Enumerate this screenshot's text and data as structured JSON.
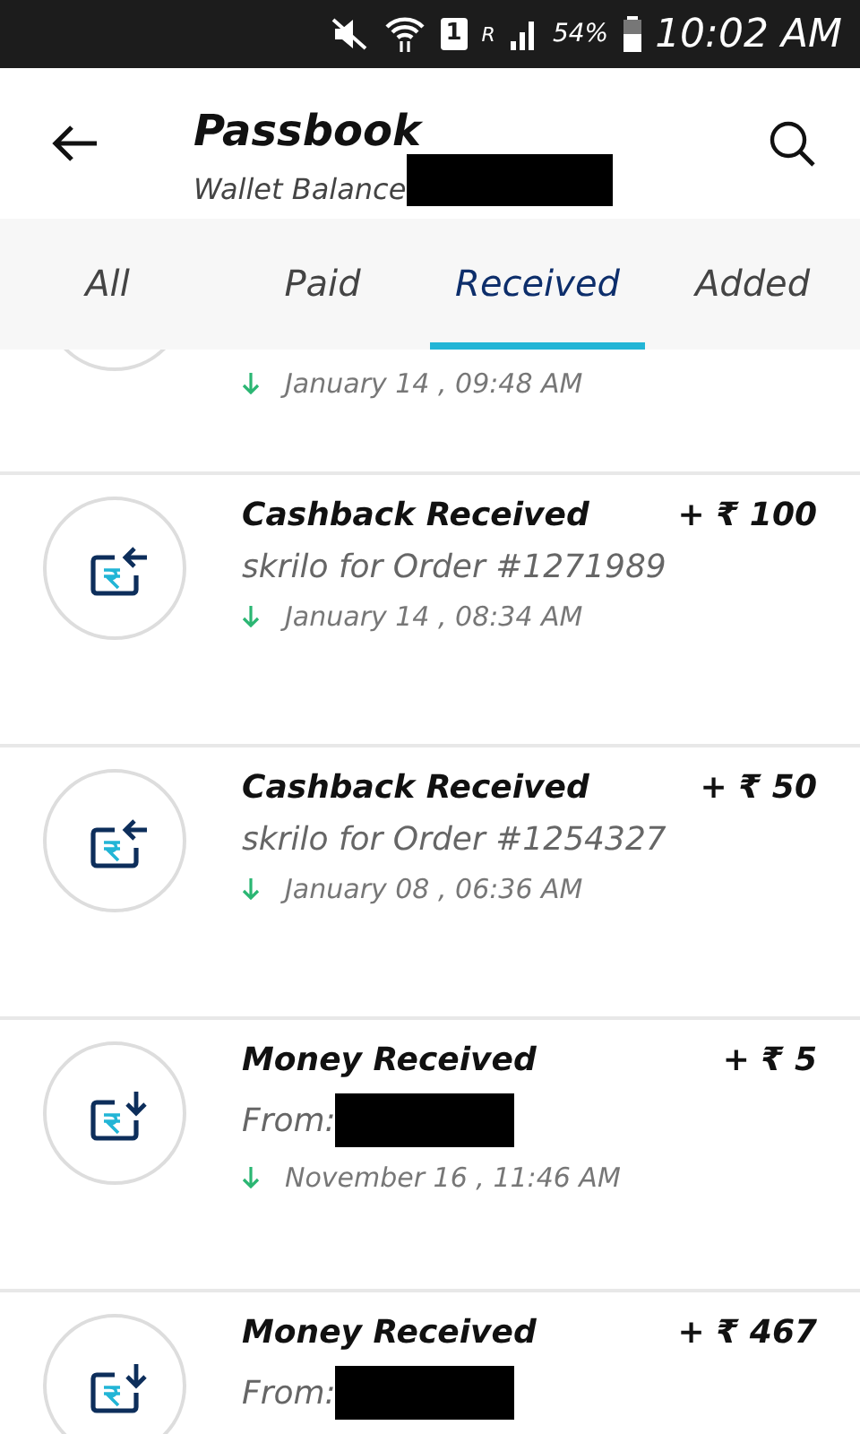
{
  "status_bar": {
    "sim": "1",
    "roaming": "R",
    "battery": "54%",
    "time": "10:02 AM"
  },
  "header": {
    "title": "Passbook",
    "subtitle": "Wallet Balance",
    "balance_redacted": true
  },
  "tabs": [
    {
      "label": "All",
      "selected": false
    },
    {
      "label": "Paid",
      "selected": false
    },
    {
      "label": "Received",
      "selected": true
    },
    {
      "label": "Added",
      "selected": false
    }
  ],
  "transactions": [
    {
      "date": "January 14 , 09:48 AM"
    },
    {
      "kind": "cashback",
      "title": "Cashback Received",
      "amount": "+ ₹ 100",
      "detail": "skrilo for Order #1271989",
      "date": "January 14 , 08:34 AM"
    },
    {
      "kind": "cashback",
      "title": "Cashback Received",
      "amount": "+ ₹ 50",
      "detail": "skrilo for Order #1254327",
      "date": "January 08 , 06:36 AM"
    },
    {
      "kind": "money",
      "title": "Money Received",
      "amount": "+ ₹ 5",
      "detail": "From:",
      "detail_redacted": true,
      "date": "November 16 , 11:46 AM"
    },
    {
      "kind": "money",
      "title": "Money Received",
      "amount": "+ ₹ 467",
      "detail": "From:",
      "detail_redacted": true
    }
  ]
}
